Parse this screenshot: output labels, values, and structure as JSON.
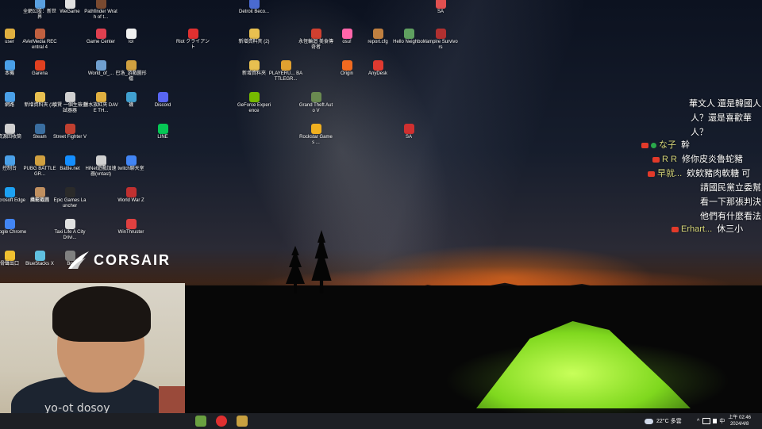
{
  "desktop_icons": [
    {
      "label": "全網公股：新世界",
      "x": 0,
      "y": 0,
      "color": "#5aa0e0",
      "icon": "app-icon"
    },
    {
      "label": "WeGame",
      "x": 0,
      "y": 0,
      "color": "#e0e0e0",
      "icon": "wegame-icon"
    },
    {
      "label": "Pathfinder Wrath of t...",
      "x": 0,
      "y": 0,
      "color": "#7a4a30",
      "icon": "pathfinder-icon"
    },
    {
      "label": "Detroit Beco...",
      "x": 0,
      "y": 0,
      "color": "#4a6ad0",
      "icon": "detroit-icon"
    },
    {
      "label": "SA",
      "x": 0,
      "y": 0,
      "color": "#e05050",
      "icon": "sa-icon"
    },
    {
      "label": "user",
      "x": 0,
      "y": 0,
      "color": "#e0b040",
      "icon": "folder-icon"
    },
    {
      "label": "AVerMedia RECentral 4",
      "x": 0,
      "y": 0,
      "color": "#c06040",
      "icon": "avermedia-icon"
    },
    {
      "label": "Game Center",
      "x": 0,
      "y": 0,
      "color": "#e04050",
      "icon": "game-center-icon"
    },
    {
      "label": "lol",
      "x": 0,
      "y": 0,
      "color": "#f0f0f0",
      "icon": "file-icon"
    },
    {
      "label": "Riot クライアント",
      "x": 0,
      "y": 0,
      "color": "#e03030",
      "icon": "riot-icon"
    },
    {
      "label": "新增資料夾 (2)",
      "x": 0,
      "y": 0,
      "color": "#e8c050",
      "icon": "folder-icon"
    },
    {
      "label": "永恆輪迴 美食傳奇者",
      "x": 0,
      "y": 0,
      "color": "#d04030",
      "icon": "game-icon"
    },
    {
      "label": "osu!",
      "x": 0,
      "y": 0,
      "color": "#ff66aa",
      "icon": "osu-icon"
    },
    {
      "label": "report.cfg",
      "x": 0,
      "y": 0,
      "color": "#c08040",
      "icon": "file-icon"
    },
    {
      "label": "Hello Neighbor",
      "x": 0,
      "y": 0,
      "color": "#60a060",
      "icon": "game-icon"
    },
    {
      "label": "Vampire Survivors",
      "x": 0,
      "y": 0,
      "color": "#b03030",
      "icon": "vampire-icon"
    },
    {
      "label": "本機",
      "x": 0,
      "y": 0,
      "color": "#4aa0e8",
      "icon": "computer-icon"
    },
    {
      "label": "Garena",
      "x": 0,
      "y": 0,
      "color": "#e04020",
      "icon": "garena-icon"
    },
    {
      "label": "World_of_...",
      "x": 0,
      "y": 0,
      "color": "#70a0d0",
      "icon": "file-icon"
    },
    {
      "label": "巴洛_游戲圖形檔",
      "x": 0,
      "y": 0,
      "color": "#d0a040",
      "icon": "game-icon"
    },
    {
      "label": "新增資料夾",
      "x": 0,
      "y": 0,
      "color": "#e8c050",
      "icon": "folder-icon"
    },
    {
      "label": "PLAYERU... BATTLEGR...",
      "x": 0,
      "y": 0,
      "color": "#e0a030",
      "icon": "pubg-icon"
    },
    {
      "label": "Origin",
      "x": 0,
      "y": 0,
      "color": "#f06a20",
      "icon": "origin-icon"
    },
    {
      "label": "AnyDesk",
      "x": 0,
      "y": 0,
      "color": "#e03a30",
      "icon": "anydesk-icon"
    },
    {
      "label": "網路",
      "x": 0,
      "y": 0,
      "color": "#4aa0e8",
      "icon": "network-icon"
    },
    {
      "label": "新增資料夾 (3)",
      "x": 0,
      "y": 0,
      "color": "#e8c050",
      "icon": "folder-icon"
    },
    {
      "label": "增賢 一個生檢查試器器",
      "x": 0,
      "y": 0,
      "color": "#d0d0d0",
      "icon": "game-icon"
    },
    {
      "label": "獵水族紅夾 DAVE TH...",
      "x": 0,
      "y": 0,
      "color": "#e0b040",
      "icon": "game-icon"
    },
    {
      "label": "襪",
      "x": 0,
      "y": 0,
      "color": "#40a0d0",
      "icon": "app-icon"
    },
    {
      "label": "Discord",
      "x": 0,
      "y": 0,
      "color": "#5865f2",
      "icon": "discord-icon"
    },
    {
      "label": "GeForce Experience",
      "x": 0,
      "y": 0,
      "color": "#76b900",
      "icon": "geforce-icon"
    },
    {
      "label": "Grand Theft Auto V",
      "x": 0,
      "y": 0,
      "color": "#6a8a50",
      "icon": "gta-icon"
    },
    {
      "label": "資源回收筒",
      "x": 0,
      "y": 0,
      "color": "#d0d0d0",
      "icon": "recycle-bin-icon"
    },
    {
      "label": "Steam",
      "x": 0,
      "y": 0,
      "color": "#3a6ea0",
      "icon": "steam-icon"
    },
    {
      "label": "Street Fighter V",
      "x": 0,
      "y": 0,
      "color": "#c04030",
      "icon": "game-icon"
    },
    {
      "label": "LINE",
      "x": 0,
      "y": 0,
      "color": "#06c755",
      "icon": "line-icon"
    },
    {
      "label": "Rockstar Games ...",
      "x": 0,
      "y": 0,
      "color": "#f0b020",
      "icon": "rockstar-icon"
    },
    {
      "label": "SA",
      "x": 0,
      "y": 0,
      "color": "#d03030",
      "icon": "sa-icon"
    },
    {
      "label": "控制台",
      "x": 0,
      "y": 0,
      "color": "#4aa0e8",
      "icon": "control-panel-icon"
    },
    {
      "label": "PUBG BATTLEGR...",
      "x": 0,
      "y": 0,
      "color": "#d0a040",
      "icon": "pubg-icon"
    },
    {
      "label": "Battle.net",
      "x": 0,
      "y": 0,
      "color": "#148eff",
      "icon": "battlenet-icon"
    },
    {
      "label": "HiNet遊戲加速器(vntast)",
      "x": 0,
      "y": 0,
      "color": "#d0d0d0",
      "icon": "app-icon"
    },
    {
      "label": "twitch聊天室",
      "x": 0,
      "y": 0,
      "color": "#4285f4",
      "icon": "chrome-icon"
    },
    {
      "label": "魔龍道具",
      "x": 0,
      "y": 0,
      "color": "#b04050",
      "icon": "game-icon"
    },
    {
      "label": "Microsoft Edge",
      "x": 0,
      "y": 0,
      "color": "#1da1f2",
      "icon": "edge-icon"
    },
    {
      "label": "攝影截圖",
      "x": 0,
      "y": 0,
      "color": "#c09060",
      "icon": "game-icon"
    },
    {
      "label": "Epic Games Launcher",
      "x": 0,
      "y": 0,
      "color": "#2a2a2a",
      "icon": "epic-icon"
    },
    {
      "label": "World War Z",
      "x": 0,
      "y": 0,
      "color": "#c03030",
      "icon": "game-icon"
    },
    {
      "label": "Google Chrome",
      "x": 0,
      "y": 0,
      "color": "#4285f4",
      "icon": "chrome-icon"
    },
    {
      "label": "Taxi Life A City Drivi...",
      "x": 0,
      "y": 0,
      "color": "#e0e0e0",
      "icon": "taxi-icon"
    },
    {
      "label": "WinThruster",
      "x": 0,
      "y": 0,
      "color": "#e04040",
      "icon": "app-icon"
    },
    {
      "label": "骨聲出口",
      "x": 0,
      "y": 0,
      "color": "#f0c030",
      "icon": "app-icon"
    },
    {
      "label": "BlueStacks X",
      "x": 0,
      "y": 0,
      "color": "#60c0e0",
      "icon": "bluestacks-icon"
    },
    {
      "label": "Bo",
      "x": 0,
      "y": 0,
      "color": "#808080",
      "icon": "app-icon"
    }
  ],
  "corsair": {
    "text": "CORSAIR"
  },
  "chat": {
    "rows": [
      {
        "nick": "",
        "text": "華文人 還是韓國人",
        "badge": "none"
      },
      {
        "nick": "",
        "text": "人？還是喜歡華",
        "badge": "none"
      },
      {
        "nick": "",
        "text": "人？",
        "badge": "none"
      },
      {
        "nick": "な子",
        "text": "幹",
        "badge": "both"
      },
      {
        "nick": "R R",
        "text": "修你皮炎魯蛇豬",
        "badge": "yt"
      },
      {
        "nick": "早就...",
        "text": "欸欸豬肉軟糖 可",
        "badge": "yt"
      },
      {
        "nick": "",
        "text": "請國民黨立委幫",
        "badge": "none"
      },
      {
        "nick": "",
        "text": "看一下那張判決",
        "badge": "none"
      },
      {
        "nick": "",
        "text": "他們有什麼看法",
        "badge": "none"
      },
      {
        "nick": "Erhart...",
        "text": "休三小",
        "badge": "yt"
      }
    ]
  },
  "webcam": {
    "shirt_text": "yo-ot dosoy"
  },
  "taskbar": {
    "weather": "22°C 多雲",
    "ime": "中",
    "time": "上午 02:46",
    "date": "2024/4/8"
  }
}
